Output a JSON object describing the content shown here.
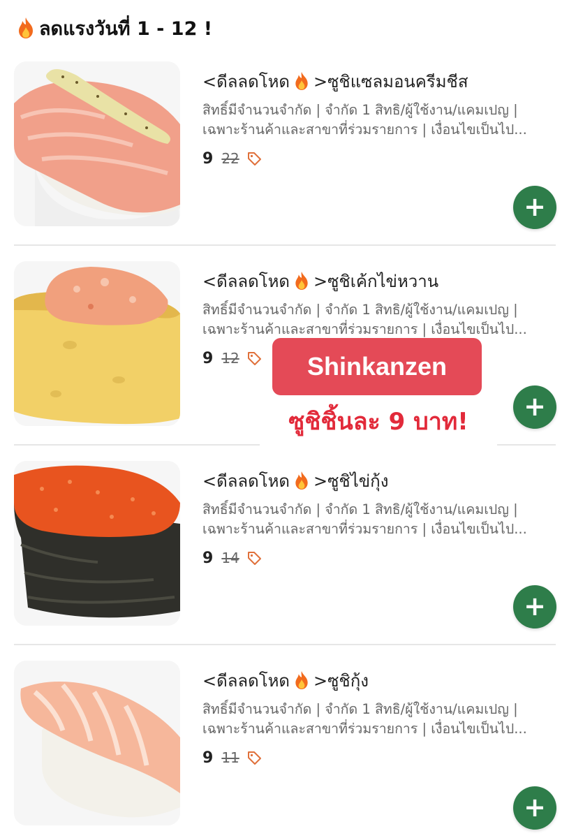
{
  "header": {
    "title": "ลดแรงวันที่ 1 - 12 !",
    "icon": "fire-icon"
  },
  "items": [
    {
      "name_prefix": "<ดีลลดโหด",
      "name_suffix": ">ซูชิแซลมอนครีมชีส",
      "desc_line1": "สิทธิ์มีจำนวนจำกัด | จำกัด 1 สิทธิ/ผู้ใช้งาน/แคมเปญ |",
      "desc_line2": "เฉพาะร้านค้าและสาขาที่ร่วมรายการ | เงื่อนไขเป็นไป...",
      "price": "9",
      "old_price": "22",
      "image": "salmon-cream-cheese-sushi"
    },
    {
      "name_prefix": "<ดีลลดโหด",
      "name_suffix": ">ซูชิเค้กไข่หวาน",
      "desc_line1": "สิทธิ์มีจำนวนจำกัด | จำกัด 1 สิทธิ/ผู้ใช้งาน/แคมเปญ |",
      "desc_line2": "เฉพาะร้านค้าและสาขาที่ร่วมรายการ | เงื่อนไขเป็นไป...",
      "price": "9",
      "old_price": "12",
      "image": "sweet-egg-cake-sushi"
    },
    {
      "name_prefix": "<ดีลลดโหด",
      "name_suffix": ">ซูชิไข่กุ้ง",
      "desc_line1": "สิทธิ์มีจำนวนจำกัด | จำกัด 1 สิทธิ/ผู้ใช้งาน/แคมเปญ |",
      "desc_line2": "เฉพาะร้านค้าและสาขาที่ร่วมรายการ | เงื่อนไขเป็นไป...",
      "price": "9",
      "old_price": "14",
      "image": "shrimp-roe-sushi"
    },
    {
      "name_prefix": "<ดีลลดโหด",
      "name_suffix": ">ซูชิกุ้ง",
      "desc_line1": "สิทธิ์มีจำนวนจำกัด | จำกัด 1 สิทธิ/ผู้ใช้งาน/แคมเปญ |",
      "desc_line2": "เฉพาะร้านค้าและสาขาที่ร่วมรายการ | เงื่อนไขเป็นไป...",
      "price": "9",
      "old_price": "11",
      "image": "shrimp-sushi"
    }
  ],
  "overlay": {
    "brand": "Shinkanzen",
    "tagline": "ซูชิชิ้นละ 9 บาท!",
    "brand_bg": "#e44a57",
    "tagline_color": "#e22a3a"
  },
  "colors": {
    "add_button": "#2e7d4a",
    "divider": "#e6e6e6",
    "tag": "#e0703a"
  }
}
